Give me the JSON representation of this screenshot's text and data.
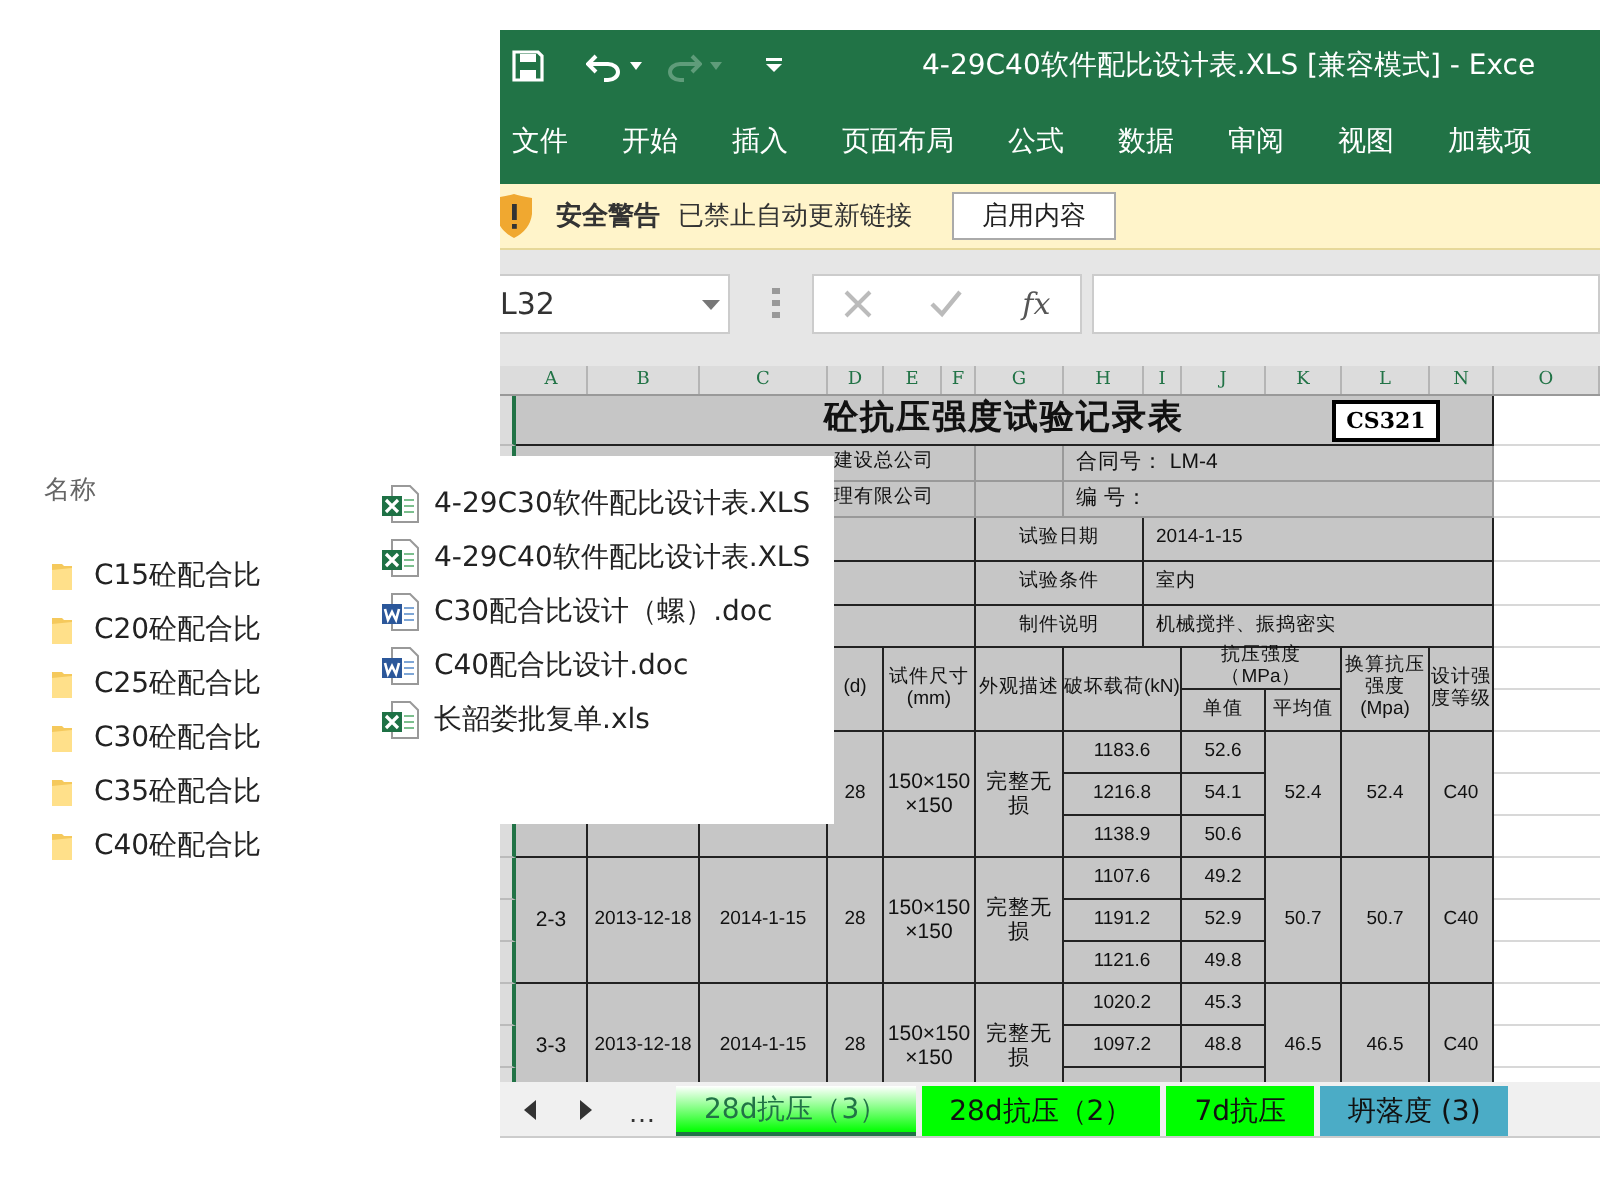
{
  "explorer": {
    "header": "名称",
    "folders": [
      {
        "name": "C15砼配合比"
      },
      {
        "name": "C20砼配合比"
      },
      {
        "name": "C25砼配合比"
      },
      {
        "name": "C30砼配合比"
      },
      {
        "name": "C35砼配合比"
      },
      {
        "name": "C40砼配合比"
      }
    ]
  },
  "file_popup": [
    {
      "name": "4-29C30软件配比设计表.XLS",
      "kind": "excel"
    },
    {
      "name": "4-29C40软件配比设计表.XLS",
      "kind": "excel"
    },
    {
      "name": "C30配合比设计（螺）.doc",
      "kind": "word"
    },
    {
      "name": "C40配合比设计.doc",
      "kind": "word"
    },
    {
      "name": "长韶娄批复单.xls",
      "kind": "excel"
    }
  ],
  "window": {
    "title": "4-29C40软件配比设计表.XLS  [兼容模式]  -  Exce"
  },
  "ribbon_tabs": [
    {
      "label": "文件"
    },
    {
      "label": "开始"
    },
    {
      "label": "插入"
    },
    {
      "label": "页面布局"
    },
    {
      "label": "公式"
    },
    {
      "label": "数据"
    },
    {
      "label": "审阅"
    },
    {
      "label": "视图"
    },
    {
      "label": "加载项"
    }
  ],
  "security_bar": {
    "title": "安全警告",
    "message": "已禁止自动更新链接",
    "button": "启用内容"
  },
  "formula_bar": {
    "name_box": "L32",
    "function_button": "fx"
  },
  "sheet": {
    "column_letters": [
      "A",
      "B",
      "C",
      "D",
      "E",
      "F",
      "G",
      "H",
      "I",
      "J",
      "K",
      "L",
      "N",
      "O"
    ],
    "title": "砼抗压强度试验记录表",
    "code": "CS321",
    "info_left": [
      "建设总公司",
      "理有限公司"
    ],
    "contract": "合同号： LM-4",
    "number": "编    号：",
    "details": [
      {
        "label": "试验日期",
        "value": "2014-1-15"
      },
      {
        "label": "试验条件",
        "value": "室内"
      },
      {
        "label": "制件说明",
        "value": "机械搅拌、振捣密实"
      }
    ],
    "headers": {
      "age": "(d)",
      "size": "试件尺寸(mm)",
      "look": "外观描述",
      "load": "破坏载荷(kN)",
      "strength": "抗压强度（MPa）",
      "single": "单值",
      "average": "平均值",
      "converted": "换算抗压强度(Mpa)",
      "grade": "设计强度等级"
    },
    "groups": [
      {
        "age": "28",
        "size": "150×150 ×150",
        "look": "完整无损",
        "loads": [
          "1183.6",
          "1216.8",
          "1138.9"
        ],
        "singles": [
          "52.6",
          "54.1",
          "50.6"
        ],
        "average": "52.4",
        "converted": "52.4",
        "grade": "C40"
      },
      {
        "id": "2-3",
        "made": "2013-12-18",
        "tested": "2014-1-15",
        "age": "28",
        "size": "150×150 ×150",
        "look": "完整无损",
        "loads": [
          "1107.6",
          "1191.2",
          "1121.6"
        ],
        "singles": [
          "49.2",
          "52.9",
          "49.8"
        ],
        "average": "50.7",
        "converted": "50.7",
        "grade": "C40"
      },
      {
        "id": "3-3",
        "made": "2013-12-18",
        "tested": "2014-1-15",
        "age": "28",
        "size": "150×150 ×150",
        "look": "完整无损",
        "loads": [
          "1020.2",
          "1097.2"
        ],
        "singles": [
          "45.3",
          "48.8"
        ],
        "average": "46.5",
        "converted": "46.5",
        "grade": "C40"
      }
    ]
  },
  "sheet_nav_more": "…",
  "sheet_tabs": [
    {
      "label": "28d抗压（3）",
      "selected": true,
      "color": "#00ff00"
    },
    {
      "label": "28d抗压（2）",
      "selected": false,
      "color": "#00ff00"
    },
    {
      "label": "7d抗压",
      "selected": false,
      "color": "#00ff00"
    },
    {
      "label": "坍落度 (3)",
      "selected": false,
      "color": "#4bacc6"
    }
  ]
}
